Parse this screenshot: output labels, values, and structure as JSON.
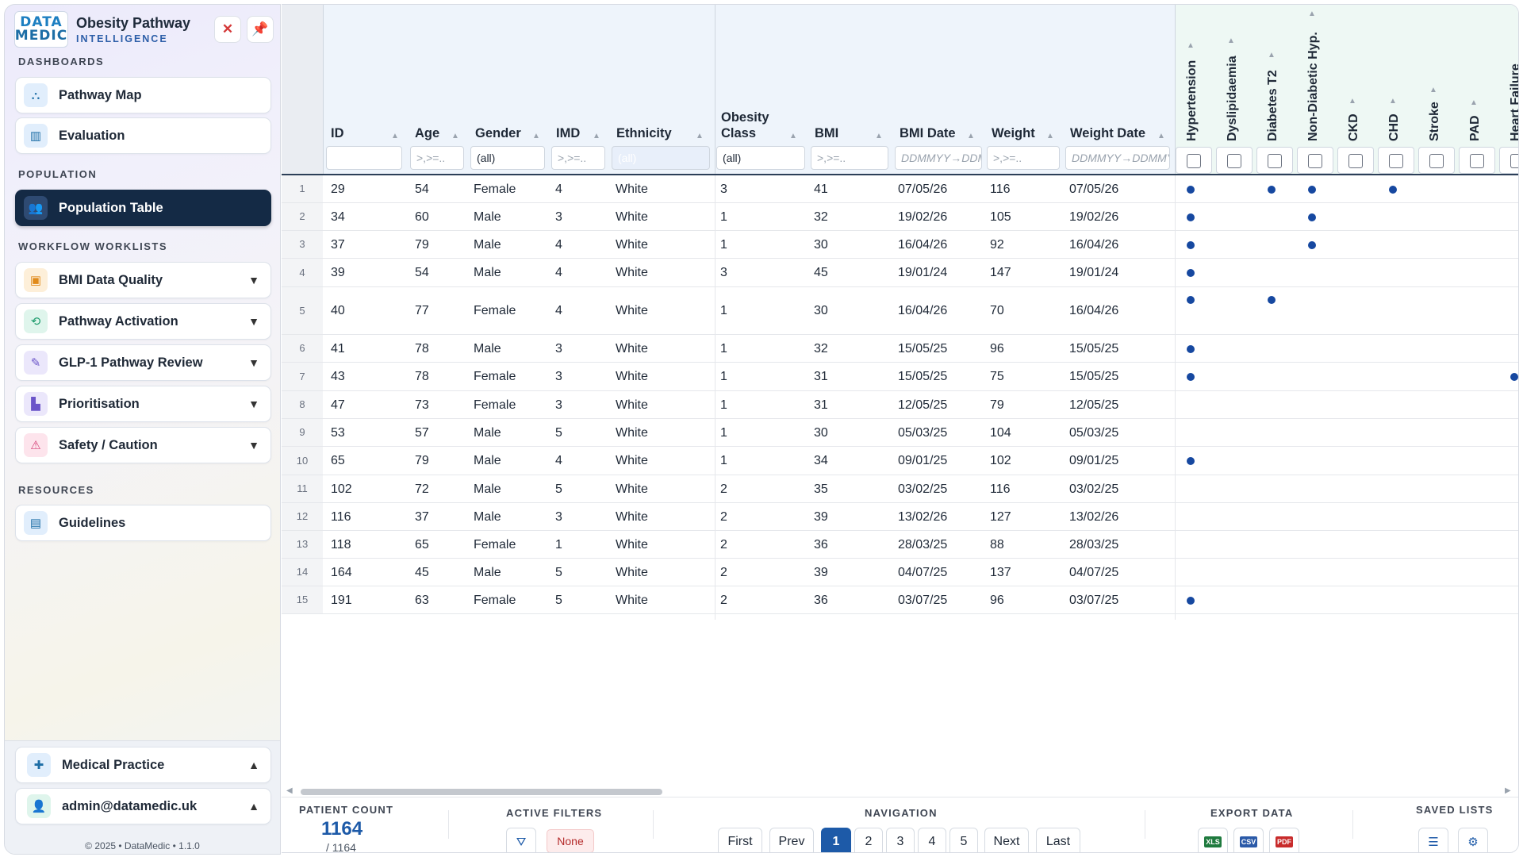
{
  "app": {
    "title": "Obesity Pathway",
    "subtitle": "INTELLIGENCE",
    "logo_top": "DATA",
    "logo_bottom": "MEDIC"
  },
  "sidebar": {
    "sections": {
      "dashboards": "DASHBOARDS",
      "population": "POPULATION",
      "workflow": "WORKFLOW WORKLISTS",
      "resources": "RESOURCES"
    },
    "items": {
      "pathway_map": "Pathway Map",
      "evaluation": "Evaluation",
      "population_table": "Population Table",
      "bmi_quality": "BMI Data Quality",
      "pathway_activation": "Pathway Activation",
      "glp1_review": "GLP-1 Pathway Review",
      "prioritisation": "Prioritisation",
      "safety": "Safety / Caution",
      "guidelines": "Guidelines"
    },
    "footer": {
      "practice": "Medical Practice",
      "user": "admin@datamedic.uk",
      "copyright": "© 2025  •  DataMedic  •  1.1.0"
    }
  },
  "table": {
    "headers": {
      "id": "ID",
      "age": "Age",
      "gender": "Gender",
      "imd": "IMD",
      "ethnicity": "Ethnicity",
      "obesity_class_1": "Obesity",
      "obesity_class_2": "Class",
      "bmi": "BMI",
      "bmi_date": "BMI Date",
      "weight": "Weight",
      "weight_date": "Weight Date"
    },
    "conditions": [
      "Hypertension",
      "Dyslipidaemia",
      "Diabetes T2",
      "Non-Diabetic Hyp.",
      "CKD",
      "CHD",
      "Stroke",
      "PAD",
      "Heart Failure"
    ],
    "filters": {
      "id": "",
      "age": ">,>=..",
      "gender": "(all)",
      "imd": ">,>=..",
      "ethnicity": "(all)",
      "obesity_class": "(all)",
      "bmi": ">,>=..",
      "bmi_date": "DDMMYY→DDMMYY",
      "weight": ">,>=..",
      "weight_date": "DDMMYY→DDMMYY"
    },
    "rows": [
      {
        "n": "1",
        "id": "29",
        "age": "54",
        "gender": "Female",
        "imd": "4",
        "eth": "White",
        "oc": "3",
        "bmi": "41",
        "bmi_date": "07/05/26",
        "weight": "116",
        "weight_date": "07/05/26",
        "flags": [
          1,
          0,
          1,
          1,
          0,
          1,
          0,
          0,
          0
        ]
      },
      {
        "n": "2",
        "id": "34",
        "age": "60",
        "gender": "Male",
        "imd": "3",
        "eth": "White",
        "oc": "1",
        "bmi": "32",
        "bmi_date": "19/02/26",
        "weight": "105",
        "weight_date": "19/02/26",
        "flags": [
          1,
          0,
          0,
          1,
          0,
          0,
          0,
          0,
          0
        ]
      },
      {
        "n": "3",
        "id": "37",
        "age": "79",
        "gender": "Male",
        "imd": "4",
        "eth": "White",
        "oc": "1",
        "bmi": "30",
        "bmi_date": "16/04/26",
        "weight": "92",
        "weight_date": "16/04/26",
        "flags": [
          1,
          0,
          0,
          1,
          0,
          0,
          0,
          0,
          0
        ]
      },
      {
        "n": "4",
        "id": "39",
        "age": "54",
        "gender": "Male",
        "imd": "4",
        "eth": "White",
        "oc": "3",
        "bmi": "45",
        "bmi_date": "19/01/24",
        "weight": "147",
        "weight_date": "19/01/24",
        "flags": [
          1,
          0,
          0,
          0,
          0,
          0,
          0,
          0,
          0
        ]
      },
      {
        "n": "5",
        "id": "40",
        "age": "77",
        "gender": "Female",
        "imd": "4",
        "eth": "White",
        "oc": "1",
        "bmi": "30",
        "bmi_date": "16/04/26",
        "weight": "70",
        "weight_date": "16/04/26",
        "flags": [
          1,
          0,
          1,
          0,
          0,
          0,
          0,
          0,
          0
        ]
      },
      {
        "n": "6",
        "id": "41",
        "age": "78",
        "gender": "Male",
        "imd": "3",
        "eth": "White",
        "oc": "1",
        "bmi": "32",
        "bmi_date": "15/05/25",
        "weight": "96",
        "weight_date": "15/05/25",
        "flags": [
          1,
          0,
          0,
          0,
          0,
          0,
          0,
          0,
          0
        ]
      },
      {
        "n": "7",
        "id": "43",
        "age": "78",
        "gender": "Female",
        "imd": "3",
        "eth": "White",
        "oc": "1",
        "bmi": "31",
        "bmi_date": "15/05/25",
        "weight": "75",
        "weight_date": "15/05/25",
        "flags": [
          1,
          0,
          0,
          0,
          0,
          0,
          0,
          0,
          1
        ]
      },
      {
        "n": "8",
        "id": "47",
        "age": "73",
        "gender": "Female",
        "imd": "3",
        "eth": "White",
        "oc": "1",
        "bmi": "31",
        "bmi_date": "12/05/25",
        "weight": "79",
        "weight_date": "12/05/25",
        "flags": [
          0,
          0,
          0,
          0,
          0,
          0,
          0,
          0,
          0
        ]
      },
      {
        "n": "9",
        "id": "53",
        "age": "57",
        "gender": "Male",
        "imd": "5",
        "eth": "White",
        "oc": "1",
        "bmi": "30",
        "bmi_date": "05/03/25",
        "weight": "104",
        "weight_date": "05/03/25",
        "flags": [
          0,
          0,
          0,
          0,
          0,
          0,
          0,
          0,
          0
        ]
      },
      {
        "n": "10",
        "id": "65",
        "age": "79",
        "gender": "Male",
        "imd": "4",
        "eth": "White",
        "oc": "1",
        "bmi": "34",
        "bmi_date": "09/01/25",
        "weight": "102",
        "weight_date": "09/01/25",
        "flags": [
          1,
          0,
          0,
          0,
          0,
          0,
          0,
          0,
          0
        ]
      },
      {
        "n": "11",
        "id": "102",
        "age": "72",
        "gender": "Male",
        "imd": "5",
        "eth": "White",
        "oc": "2",
        "bmi": "35",
        "bmi_date": "03/02/25",
        "weight": "116",
        "weight_date": "03/02/25",
        "flags": [
          0,
          0,
          0,
          0,
          0,
          0,
          0,
          0,
          0
        ]
      },
      {
        "n": "12",
        "id": "116",
        "age": "37",
        "gender": "Male",
        "imd": "3",
        "eth": "White",
        "oc": "2",
        "bmi": "39",
        "bmi_date": "13/02/26",
        "weight": "127",
        "weight_date": "13/02/26",
        "flags": [
          0,
          0,
          0,
          0,
          0,
          0,
          0,
          0,
          0
        ]
      },
      {
        "n": "13",
        "id": "118",
        "age": "65",
        "gender": "Female",
        "imd": "1",
        "eth": "White",
        "oc": "2",
        "bmi": "36",
        "bmi_date": "28/03/25",
        "weight": "88",
        "weight_date": "28/03/25",
        "flags": [
          0,
          0,
          0,
          0,
          0,
          0,
          0,
          0,
          0
        ]
      },
      {
        "n": "14",
        "id": "164",
        "age": "45",
        "gender": "Male",
        "imd": "5",
        "eth": "White",
        "oc": "2",
        "bmi": "39",
        "bmi_date": "04/07/25",
        "weight": "137",
        "weight_date": "04/07/25",
        "flags": [
          0,
          0,
          0,
          0,
          0,
          0,
          0,
          0,
          0
        ]
      },
      {
        "n": "15",
        "id": "191",
        "age": "63",
        "gender": "Female",
        "imd": "5",
        "eth": "White",
        "oc": "2",
        "bmi": "36",
        "bmi_date": "03/07/25",
        "weight": "96",
        "weight_date": "03/07/25",
        "flags": [
          1,
          0,
          0,
          0,
          0,
          0,
          0,
          0,
          0
        ]
      }
    ]
  },
  "footer": {
    "patient_count_label": "PATIENT COUNT",
    "patient_count": "1164",
    "patient_total": "/ 1164",
    "active_filters_label": "ACTIVE FILTERS",
    "active_filters_value": "None",
    "navigation_label": "NAVIGATION",
    "nav": {
      "first": "First",
      "prev": "Prev",
      "next": "Next",
      "last": "Last",
      "pages": [
        "1",
        "2",
        "3",
        "4",
        "5"
      ],
      "current": "1"
    },
    "export_label": "EXPORT DATA",
    "export_formats": [
      "XLS",
      "CSV",
      "PDF"
    ],
    "saved_lists_label": "SAVED LISTS"
  },
  "colors": {
    "accent": "#1d5aa8",
    "active_nav": "#142a45",
    "dot": "#1648a0",
    "danger": "#d43838"
  }
}
